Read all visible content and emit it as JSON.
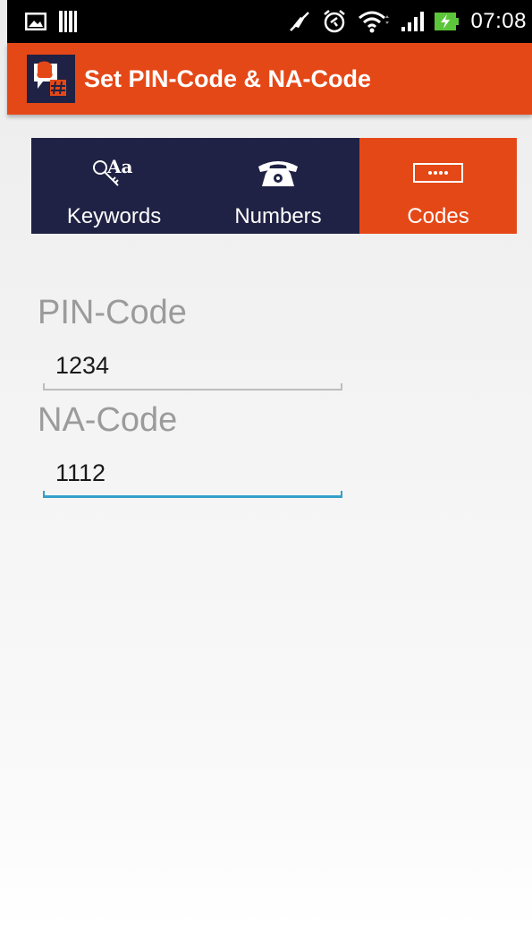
{
  "status_bar": {
    "time": "07:08",
    "left_icons": [
      "image-icon",
      "barcode-icon"
    ],
    "right_icons": [
      "mute-icon",
      "alarm-icon",
      "wifi-icon",
      "signal-icon",
      "battery-charging-icon"
    ]
  },
  "app_bar": {
    "title": "Set PIN-Code & NA-Code",
    "logo_icon": "app-logo-icon",
    "color": "#e54817"
  },
  "tabs": [
    {
      "label": "Keywords",
      "icon": "key-aa-icon",
      "selected": false
    },
    {
      "label": "Numbers",
      "icon": "telephone-icon",
      "selected": false
    },
    {
      "label": "Codes",
      "icon": "password-field-icon",
      "selected": true
    }
  ],
  "form": {
    "pin": {
      "label": "PIN-Code",
      "value": "1234"
    },
    "na": {
      "label": "NA-Code",
      "value": "1112"
    }
  },
  "colors": {
    "accent": "#e54817",
    "tab_bg": "#1f2244",
    "focus": "#33a0c9"
  }
}
